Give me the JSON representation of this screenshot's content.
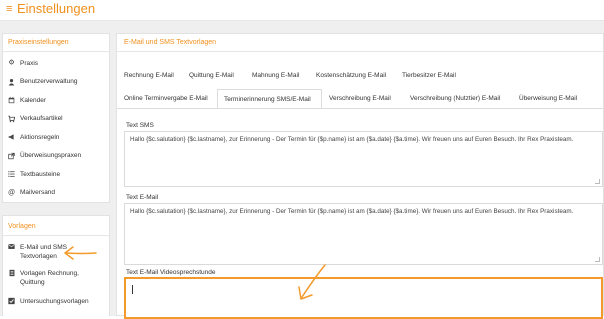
{
  "app": {
    "title": "Einstellungen",
    "menu_icon": "hamburger-icon",
    "accent_color": "#f0901e"
  },
  "sidebar": {
    "praxis_header": "Praxiseinstellungen",
    "praxis_items": [
      {
        "label": "Praxis",
        "icon": "gear-icon"
      },
      {
        "label": "Benutzerverwaltung",
        "icon": "user-icon"
      },
      {
        "label": "Kalender",
        "icon": "calendar-icon"
      },
      {
        "label": "Verkaufsartikel",
        "icon": "cart-icon"
      },
      {
        "label": "Aktionsregeln",
        "icon": "megaphone-icon"
      },
      {
        "label": "Überweisungspraxen",
        "icon": "external-link-icon"
      },
      {
        "label": "Textbausteine",
        "icon": "list-icon"
      },
      {
        "label": "Mailversand",
        "icon": "at-icon"
      }
    ],
    "vorlagen_header": "Vorlagen",
    "vorlagen_items": [
      {
        "label_line1": "E-Mail und SMS",
        "label_line2": "Textvorlagen",
        "icon": "envelope-icon"
      },
      {
        "label_line1": "Vorlagen Rechnung,",
        "label_line2": "Quittung",
        "icon": "document-icon"
      },
      {
        "label_line1": "Untersuchungsvorlagen",
        "label_line2": "",
        "icon": "checkbox-icon"
      }
    ]
  },
  "main": {
    "header": "E-Mail und SMS Textvorlagen",
    "tabs_row1": [
      "Rechnung E-Mail",
      "Quittung E-Mail",
      "Mahnung E-Mail",
      "Kostenschätzung E-Mail",
      "Tierbesitzer E-Mail"
    ],
    "tabs_row2": [
      "Online Terminvergabe E-Mail",
      "Terminerinnerung SMS/E-Mail",
      "Verschreibung E-Mail",
      "Verschreibung (Nutztier) E-Mail",
      "Überweisung E-Mail"
    ],
    "active_tab": "Terminerinnerung SMS/E-Mail",
    "fields": {
      "sms_label": "Text SMS",
      "sms_value": "Hallo {$c.salutation} {$c.lastname}, zur Erinnerung - Der Termin für {$p.name} ist am {$a.date} {$a.time}. Wir freuen uns auf Euren Besuch. Ihr Rex Praxisteam.",
      "email_label": "Text E-Mail",
      "email_value": "Hallo {$c.salutation} {$c.lastname}, zur Erinnerung - Der Termin für {$p.name} ist am {$a.date} {$a.time}. Wir freuen uns auf Euren Besuch. Ihr Rex Praxisteam.",
      "video_label": "Text E-Mail Videosprechstunde",
      "video_value": ""
    }
  },
  "annotation_color": "#f39a2b"
}
